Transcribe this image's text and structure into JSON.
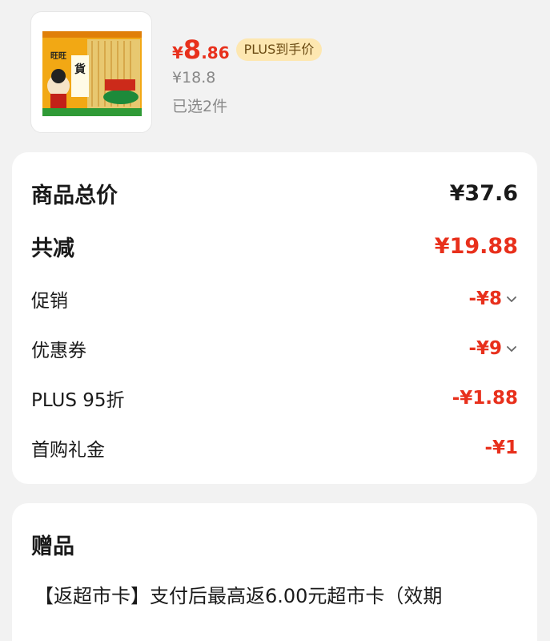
{
  "product": {
    "image_alt": "旺旺 仙贝 零食大礼包",
    "price_currency": "¥",
    "price_int": "8",
    "price_dec": ".86",
    "plus_badge": "PLUS到手价",
    "original_price": "¥18.8",
    "selected_count": "已选2件"
  },
  "summary": {
    "total_label": "商品总价",
    "total_value": "¥37.6",
    "reduce_label": "共减",
    "reduce_value": "¥19.88",
    "items": [
      {
        "label": "促销",
        "value": "-¥8",
        "has_chevron": true
      },
      {
        "label": "优惠券",
        "value": "-¥9",
        "has_chevron": true
      },
      {
        "label": "PLUS 95折",
        "value": "-¥1.88",
        "has_chevron": false
      },
      {
        "label": "首购礼金",
        "value": "-¥1",
        "has_chevron": false
      }
    ]
  },
  "gift": {
    "title": "赠品",
    "text": "【返超市卡】支付后最高返6.00元超市卡（效期"
  },
  "colors": {
    "accent": "#e8301c",
    "badge_bg": "#fde7b1",
    "badge_text": "#6a4a12"
  }
}
